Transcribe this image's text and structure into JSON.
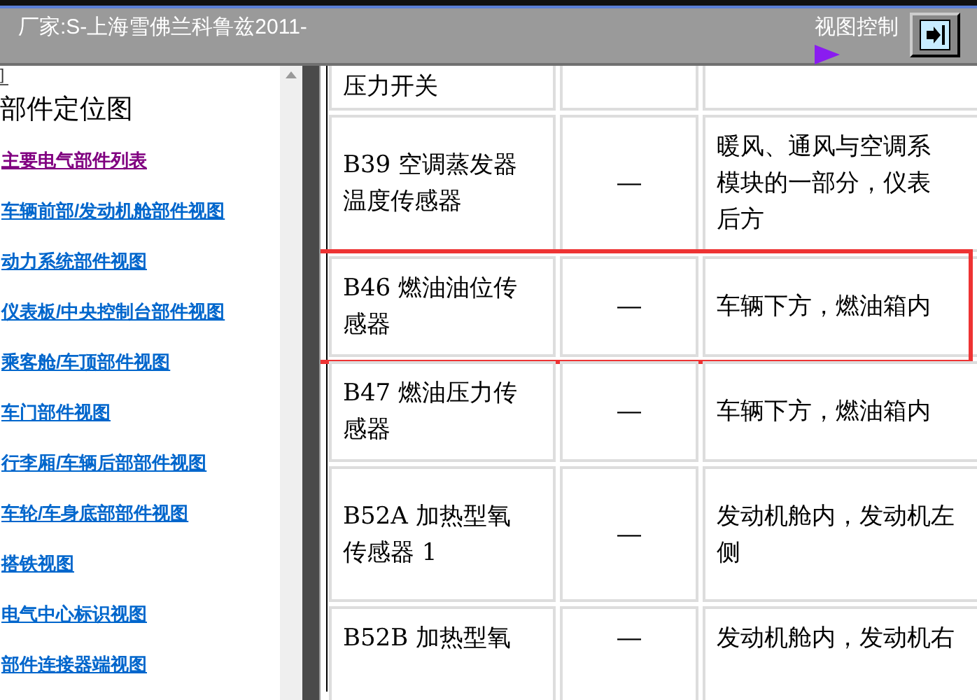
{
  "header": {
    "title": "厂家:S-上海雪佛兰科鲁兹2011-",
    "view_control": "视图控制"
  },
  "sidebar": {
    "bracket": "]",
    "heading": "部件定位图",
    "links": [
      {
        "label": "主要电气部件列表",
        "visited": true
      },
      {
        "label": "车辆前部/发动机舱部件视图",
        "visited": false
      },
      {
        "label": "动力系统部件视图",
        "visited": false
      },
      {
        "label": "仪表板/中央控制台部件视图",
        "visited": false
      },
      {
        "label": "乘客舱/车顶部件视图",
        "visited": false
      },
      {
        "label": "车门部件视图",
        "visited": false
      },
      {
        "label": "行李厢/车辆后部部件视图",
        "visited": false
      },
      {
        "label": "车轮/车身底部部件视图",
        "visited": false
      },
      {
        "label": "搭铁视图",
        "visited": false
      },
      {
        "label": "电气中心标识视图",
        "visited": false
      },
      {
        "label": "部件连接器端视图",
        "visited": false
      }
    ]
  },
  "table": {
    "rows": [
      {
        "name": [
          "压力开关"
        ],
        "column_2": "",
        "location": [],
        "highlighted": false
      },
      {
        "name": [
          "B39 空调蒸发器",
          "温度传感器"
        ],
        "column_2": "—",
        "location": [
          "暖风、通风与空调系",
          "模块的一部分，仪表",
          "后方"
        ],
        "highlighted": false
      },
      {
        "name": [
          "B46 燃油油位传",
          "感器"
        ],
        "column_2": "—",
        "location": [
          "车辆下方，燃油箱内"
        ],
        "highlighted": true
      },
      {
        "name": [
          "B47 燃油压力传",
          "感器"
        ],
        "column_2": "—",
        "location": [
          "车辆下方，燃油箱内"
        ],
        "highlighted": false
      },
      {
        "name": [
          "B52A 加热型氧",
          "传感器 1"
        ],
        "column_2": "—",
        "location": [
          "发动机舱内，发动机左",
          "侧"
        ],
        "highlighted": false
      },
      {
        "name": [
          "B52B 加热型氧"
        ],
        "column_2": "—",
        "location": [
          "发动机舱内，发动机右"
        ],
        "highlighted": false
      }
    ]
  }
}
